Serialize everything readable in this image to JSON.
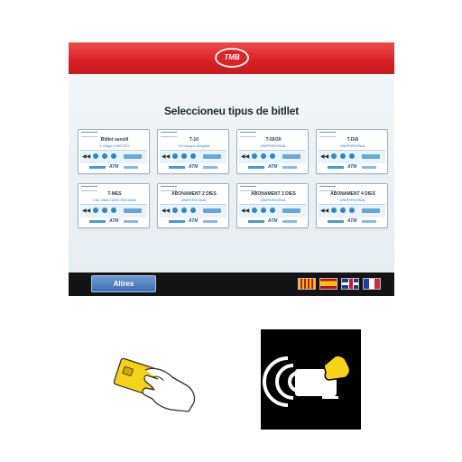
{
  "kiosk": {
    "logo_text": "TMB",
    "title": "Seleccioneu tipus de bitllet",
    "tickets": [
      {
        "name": "Bitllet senzill",
        "subtitle": "1 viatge a METRO"
      },
      {
        "name": "T-10",
        "subtitle": "10 viatges integrats"
      },
      {
        "name": "T-50/30",
        "subtitle": "UNIPERSONAL"
      },
      {
        "name": "T-DIA",
        "subtitle": "UNIPERSONAL"
      },
      {
        "name": "T-MES",
        "subtitle": "CAL UNA CARD ENVIADA"
      },
      {
        "name": "ABONAMENT 2 DIES",
        "subtitle": "UNIPERSONAL"
      },
      {
        "name": "ABONAMENT 3 DIES",
        "subtitle": "UNIPERSONAL"
      },
      {
        "name": "ABONAMENT 4 DIES",
        "subtitle": "UNIPERSONAL"
      }
    ],
    "card_logo": "ATM",
    "more_button": "Altres",
    "languages": [
      "catalan-flag-icon",
      "spanish-flag-icon",
      "english-flag-icon",
      "french-flag-icon"
    ]
  },
  "pictograms": {
    "insert_card": "card-insert-icon",
    "contactless": "contactless-icon"
  },
  "colors": {
    "header_red": "#d81f24",
    "button_blue": "#4a78bb",
    "card_yellow": "#f3d416"
  }
}
